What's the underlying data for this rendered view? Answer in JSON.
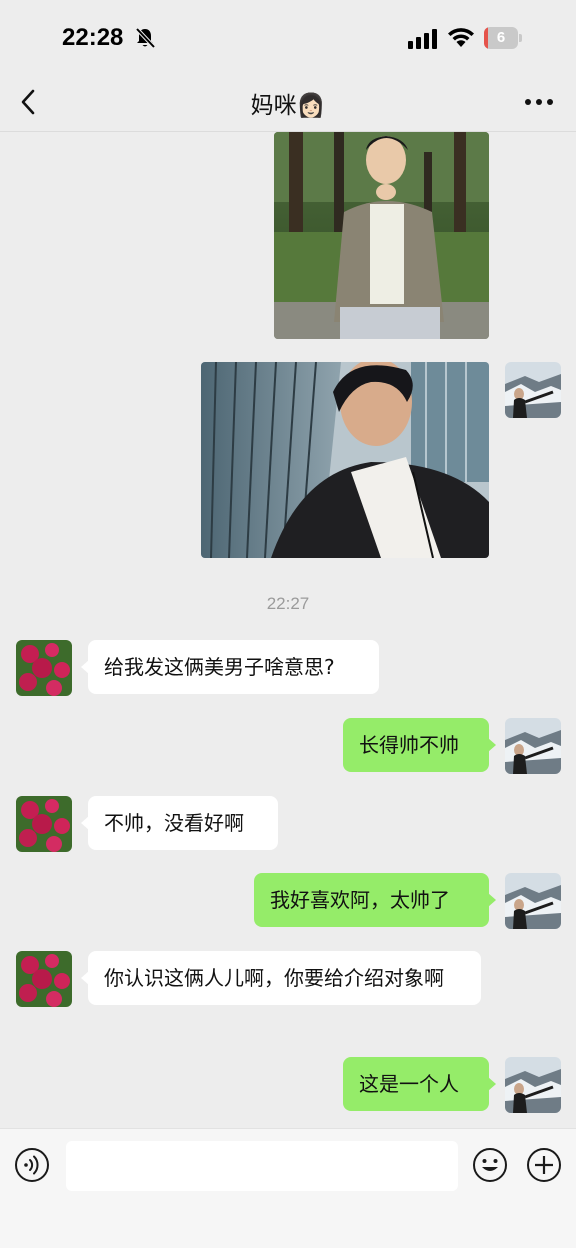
{
  "status_bar": {
    "time": "22:28",
    "battery_label": "6",
    "battery_level": 0.06
  },
  "header": {
    "title": "妈咪👩🏻",
    "back_icon": "chevron-left-icon",
    "more_icon": "more-dots-icon"
  },
  "chat": {
    "timestamp": "22:27",
    "messages": [
      {
        "sender": "me",
        "type": "image",
        "content": "photo of young man sitting in a park"
      },
      {
        "sender": "me",
        "type": "image",
        "content": "photo of young man in black jacket selfie by building"
      },
      {
        "sender": "contact",
        "type": "text",
        "text": "给我发这俩美男子啥意思?"
      },
      {
        "sender": "me",
        "type": "text",
        "text": "长得帅不帅"
      },
      {
        "sender": "contact",
        "type": "text",
        "text": "不帅，没看好啊"
      },
      {
        "sender": "me",
        "type": "text",
        "text": "我好喜欢阿，太帅了"
      },
      {
        "sender": "contact",
        "type": "text",
        "text": "你认识这俩人儿啊，你要给介绍对象啊"
      },
      {
        "sender": "me",
        "type": "text",
        "text": "这是一个人"
      }
    ]
  },
  "input_bar": {
    "placeholder": "",
    "value": "",
    "icons": [
      "voice-icon",
      "emoji-icon",
      "plus-icon"
    ]
  },
  "colors": {
    "background": "#ededed",
    "my_bubble": "#95ec69",
    "their_bubble": "#ffffff",
    "battery_low": "#e5534b"
  }
}
